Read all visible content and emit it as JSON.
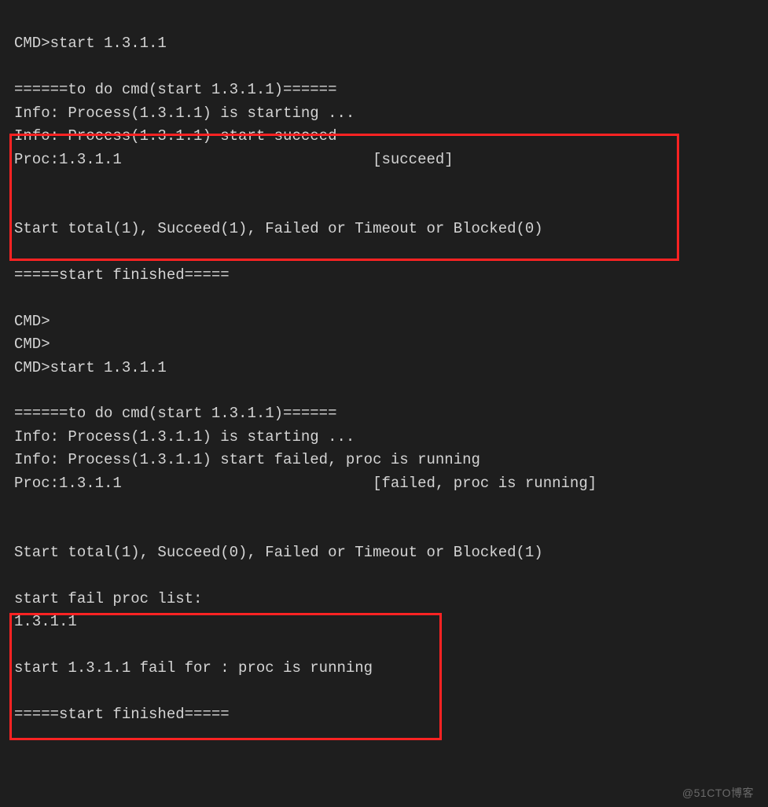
{
  "terminal": {
    "lines": [
      "CMD>start 1.3.1.1",
      "",
      "======to do cmd(start 1.3.1.1)======",
      "Info: Process(1.3.1.1) is starting ...",
      "Info: Process(1.3.1.1) start succeed",
      "Proc:1.3.1.1                            [succeed]",
      "",
      "",
      "Start total(1), Succeed(1), Failed or Timeout or Blocked(0)",
      "",
      "=====start finished=====",
      "",
      "CMD>",
      "CMD>",
      "CMD>start 1.3.1.1",
      "",
      "======to do cmd(start 1.3.1.1)======",
      "Info: Process(1.3.1.1) is starting ...",
      "Info: Process(1.3.1.1) start failed, proc is running",
      "Proc:1.3.1.1                            [failed, proc is running]",
      "",
      "",
      "Start total(1), Succeed(0), Failed or Timeout or Blocked(1)",
      "",
      "start fail proc list:",
      "1.3.1.1",
      "",
      "start 1.3.1.1 fail for : proc is running",
      "",
      "=====start finished====="
    ]
  },
  "watermark": "@51CTO博客"
}
